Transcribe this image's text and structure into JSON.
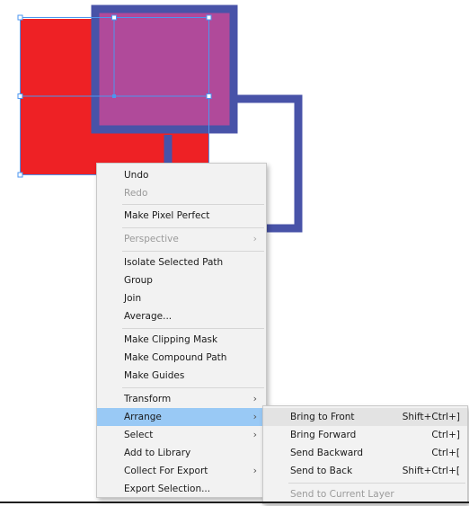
{
  "colors": {
    "red_shape": "#ee2125",
    "purple_fill": "#b04a9a",
    "stroke_blue": "#4853a8",
    "selection": "#4b96f0",
    "menu_bg": "#f2f2f2",
    "highlight": "#99c9f5"
  },
  "context_menu": {
    "items": [
      {
        "label": "Undo"
      },
      {
        "label": "Redo",
        "disabled": true
      },
      {
        "label": "Make Pixel Perfect"
      },
      {
        "label": "Perspective",
        "disabled": true,
        "submenu": true
      },
      {
        "label": "Isolate Selected Path"
      },
      {
        "label": "Group"
      },
      {
        "label": "Join"
      },
      {
        "label": "Average..."
      },
      {
        "label": "Make Clipping Mask"
      },
      {
        "label": "Make Compound Path"
      },
      {
        "label": "Make Guides"
      },
      {
        "label": "Transform",
        "submenu": true
      },
      {
        "label": "Arrange",
        "submenu": true,
        "highlighted": true
      },
      {
        "label": "Select",
        "submenu": true
      },
      {
        "label": "Add to Library"
      },
      {
        "label": "Collect For Export",
        "submenu": true
      },
      {
        "label": "Export Selection..."
      }
    ]
  },
  "arrange_submenu": {
    "items": [
      {
        "label": "Bring to Front",
        "shortcut": "Shift+Ctrl+]"
      },
      {
        "label": "Bring Forward",
        "shortcut": "Ctrl+]"
      },
      {
        "label": "Send Backward",
        "shortcut": "Ctrl+["
      },
      {
        "label": "Send to Back",
        "shortcut": "Shift+Ctrl+["
      },
      {
        "label": "Send to Current Layer",
        "disabled": true
      }
    ]
  }
}
